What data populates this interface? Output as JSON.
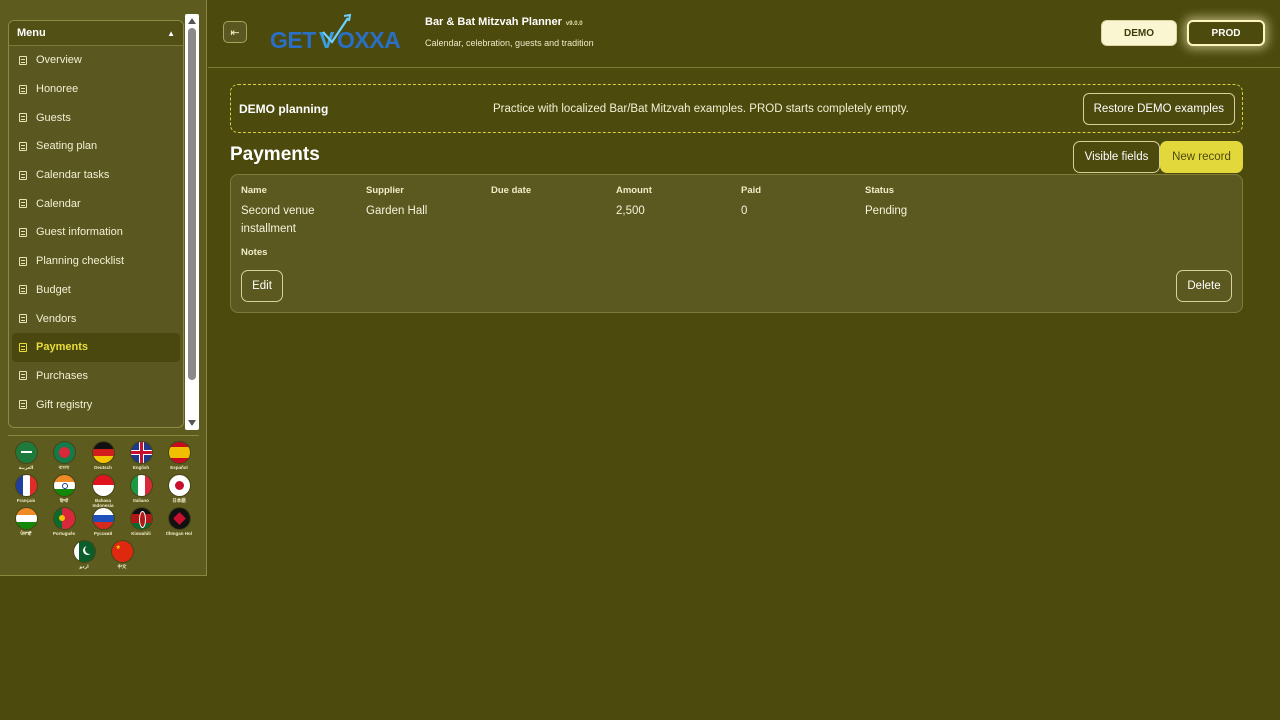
{
  "sidebar": {
    "menu_title": "Menu",
    "items": [
      {
        "label": "Overview",
        "name": "sidebar-item-overview",
        "active": false
      },
      {
        "label": "Honoree",
        "name": "sidebar-item-honoree",
        "active": false
      },
      {
        "label": "Guests",
        "name": "sidebar-item-guests",
        "active": false
      },
      {
        "label": "Seating plan",
        "name": "sidebar-item-seating-plan",
        "active": false
      },
      {
        "label": "Calendar tasks",
        "name": "sidebar-item-calendar-tasks",
        "active": false
      },
      {
        "label": "Calendar",
        "name": "sidebar-item-calendar",
        "active": false
      },
      {
        "label": "Guest information",
        "name": "sidebar-item-guest-information",
        "active": false
      },
      {
        "label": "Planning checklist",
        "name": "sidebar-item-planning-checklist",
        "active": false
      },
      {
        "label": "Budget",
        "name": "sidebar-item-budget",
        "active": false
      },
      {
        "label": "Vendors",
        "name": "sidebar-item-vendors",
        "active": false
      },
      {
        "label": "Payments",
        "name": "sidebar-item-payments",
        "active": true
      },
      {
        "label": "Purchases",
        "name": "sidebar-item-purchases",
        "active": false
      },
      {
        "label": "Gift registry",
        "name": "sidebar-item-gift-registry",
        "active": false
      }
    ],
    "languages": [
      {
        "label": "العربية",
        "code": "ar"
      },
      {
        "label": "বাংলা",
        "code": "bn"
      },
      {
        "label": "Deutsch",
        "code": "de"
      },
      {
        "label": "English",
        "code": "en"
      },
      {
        "label": "Español",
        "code": "es"
      },
      {
        "label": "Français",
        "code": "fr"
      },
      {
        "label": "हिन्दी",
        "code": "hi"
      },
      {
        "label": "Bahasa Indonesia",
        "code": "id"
      },
      {
        "label": "Italiano",
        "code": "it"
      },
      {
        "label": "日本語",
        "code": "ja"
      },
      {
        "label": "ਪੰਜਾਬੀ",
        "code": "pa"
      },
      {
        "label": "Português",
        "code": "pt"
      },
      {
        "label": "Русский",
        "code": "ru"
      },
      {
        "label": "Kiswahili",
        "code": "sw"
      },
      {
        "label": "tlhIngan Hol",
        "code": "tlh"
      },
      {
        "label": "اردو",
        "code": "ur"
      },
      {
        "label": "中文",
        "code": "zh"
      }
    ]
  },
  "header": {
    "logo_text": "GETVOXXA",
    "title": "Bar & Bat Mitzvah Planner",
    "version": "v9.0.0",
    "subtitle": "Calendar, celebration, guests and tradition",
    "demo_label": "DEMO",
    "prod_label": "PROD"
  },
  "banner": {
    "title": "DEMO planning",
    "text": "Practice with localized Bar/Bat Mitzvah examples. PROD starts completely empty.",
    "restore_label": "Restore DEMO examples"
  },
  "page": {
    "title": "Payments",
    "visible_fields_label": "Visible fields",
    "new_record_label": "New record"
  },
  "record": {
    "columns": [
      {
        "header": "Name",
        "value": "Second venue installment"
      },
      {
        "header": "Supplier",
        "value": "Garden Hall"
      },
      {
        "header": "Due date",
        "value": ""
      },
      {
        "header": "Amount",
        "value": "2,500"
      },
      {
        "header": "Paid",
        "value": "0"
      },
      {
        "header": "Status",
        "value": "Pending"
      }
    ],
    "notes_label": "Notes",
    "edit_label": "Edit",
    "delete_label": "Delete"
  },
  "colors": {
    "background": "#4c4a0d",
    "accent": "#e3d83b",
    "panel": "#5b591f"
  }
}
